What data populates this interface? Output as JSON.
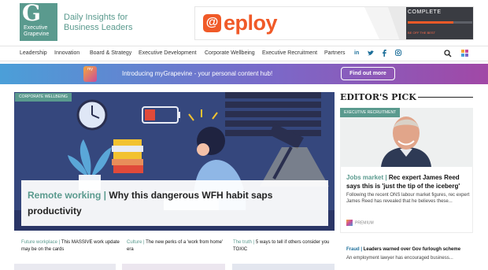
{
  "header": {
    "logo_letter": "G",
    "logo_line1": "Executive",
    "logo_line2": "Grapevine",
    "tagline_1": "Daily Insights for",
    "tagline_2": "Business Leaders"
  },
  "ad": {
    "brand": "eploy",
    "mark": "@",
    "complete": "COMPLETE",
    "tag": "BE OFF THE BEST"
  },
  "nav": {
    "items": [
      "Leadership",
      "Innovation",
      "Board & Strategy",
      "Executive Development",
      "Corporate Wellbeing",
      "Executive Recruitment",
      "Partners"
    ],
    "social": [
      "in",
      "y",
      "f",
      "o"
    ]
  },
  "promo": {
    "icon_label": "my",
    "text": "Introducing myGrapevine - your personal content hub!",
    "button": "Find out more"
  },
  "feature": {
    "tag": "CORPORATE WELLBEING",
    "kicker": "Remote working |",
    "title": "Why this dangerous WFH habit saps productivity"
  },
  "subs": [
    {
      "kicker": "Future workplace |",
      "title": "This MASSIVE work update may be on the cards"
    },
    {
      "kicker": "Culture |",
      "title": "The new perks of a 'work from home' era"
    },
    {
      "kicker": "The truth |",
      "title": "5 ways to tell if others consider you TOXIC"
    }
  ],
  "sidebar": {
    "title": "EDITOR'S PICK",
    "tag": "EXECUTIVE RECRUITMENT",
    "kicker": "Jobs market |",
    "headline": "Rec expert James Reed says this is 'just the tip of the iceberg'",
    "body": "Following the recent ONS labour market figures, rec expert James Reed has revealed that he believes these...",
    "premium": "PREMIUM",
    "item2_kicker": "Fraud |",
    "item2_title": "Leaders warned over Gov furlough scheme",
    "item2_body": "An employment lawyer has encouraged business..."
  },
  "colors": {
    "brand_teal": "#5a9a8e",
    "ad_orange": "#f05a28",
    "feature_navy": "#35477d",
    "link_blue": "#1d6f9a"
  }
}
